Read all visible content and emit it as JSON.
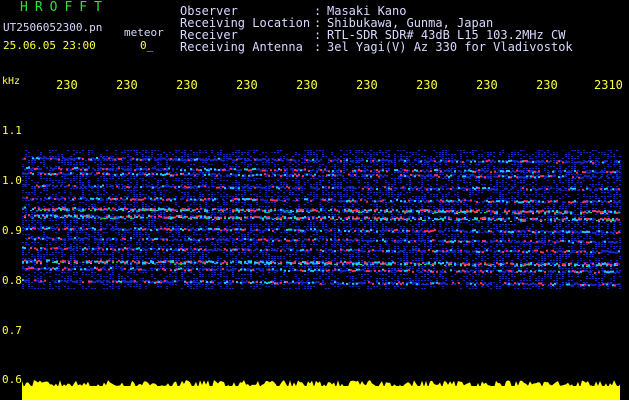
{
  "app": {
    "title": "HROFFT",
    "file_name": "UT2506052300.pn",
    "file_tag": "meteor",
    "file_datetime": "25.06.05 23:00",
    "file_extra": "0_"
  },
  "header_info": {
    "rows": [
      {
        "label": "Observer",
        "value": "Masaki Kano"
      },
      {
        "label": "Receiving Location",
        "value": "Shibukawa, Gunma, Japan"
      },
      {
        "label": "Receiver",
        "value": "RTL-SDR SDR# 43dB L15 103.2MHz CW"
      },
      {
        "label": "Receiving Antenna",
        "value": "3el Yagi(V) Az 330 for Vladivostok"
      }
    ]
  },
  "colors": {
    "background": "#000000",
    "axis_text": "#ffff40",
    "header_text": "#d8d8ff",
    "title": "#2fe030",
    "signal_low": "#1428c8",
    "signal_mid": "#20c8ff",
    "signal_high": "#ff3060",
    "baseline": "#ffff00"
  },
  "chart_data": {
    "type": "heatmap",
    "y_unit": "kHz",
    "y_ticks": [
      "1.1",
      "1.0",
      "0.9",
      "0.8",
      "0.7",
      "0.6"
    ],
    "x_ticks": [
      "230",
      "230",
      "230",
      "230",
      "230",
      "230",
      "230",
      "230",
      "230",
      "2310"
    ],
    "ylim": [
      0.6,
      1.1
    ],
    "bands_khz": [
      {
        "freq": 1.045,
        "level": 0.3
      },
      {
        "freq": 1.025,
        "level": 0.55
      },
      {
        "freq": 1.015,
        "level": 0.45
      },
      {
        "freq": 0.99,
        "level": 0.45
      },
      {
        "freq": 0.965,
        "level": 0.6
      },
      {
        "freq": 0.945,
        "level": 0.95
      },
      {
        "freq": 0.93,
        "level": 0.9
      },
      {
        "freq": 0.905,
        "level": 0.55
      },
      {
        "freq": 0.885,
        "level": 0.5
      },
      {
        "freq": 0.865,
        "level": 0.55
      },
      {
        "freq": 0.84,
        "level": 0.95
      },
      {
        "freq": 0.825,
        "level": 0.6
      },
      {
        "freq": 0.8,
        "level": 0.4
      }
    ],
    "signal_range_khz": [
      0.78,
      1.06
    ],
    "noise_floor_khz": 0.6
  }
}
